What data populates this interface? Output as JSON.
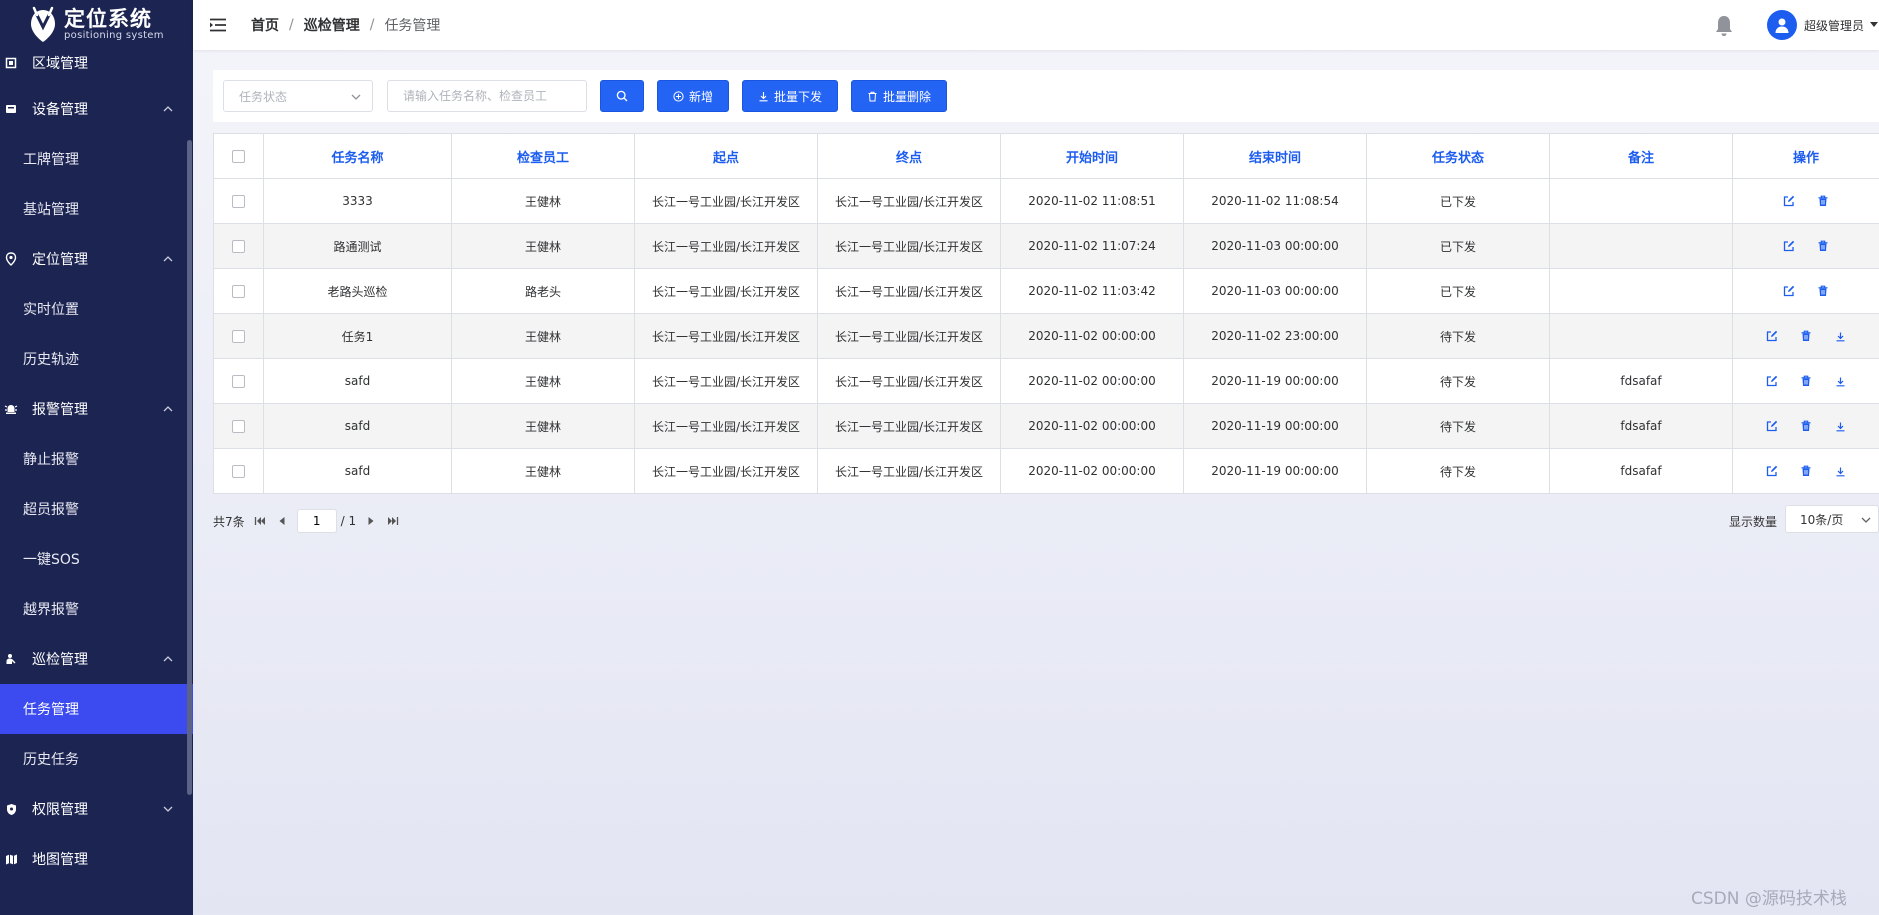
{
  "app": {
    "title": "定位系统",
    "subtitle": "positioning system"
  },
  "sidebar": {
    "groups": [
      {
        "label": "区域管理",
        "icon": "area-icon"
      },
      {
        "label": "设备管理",
        "icon": "device-icon",
        "expanded": true,
        "items": [
          "工牌管理",
          "基站管理"
        ]
      },
      {
        "label": "定位管理",
        "icon": "location-pin-icon",
        "expanded": true,
        "items": [
          "实时位置",
          "历史轨迹"
        ]
      },
      {
        "label": "报警管理",
        "icon": "alarm-icon",
        "expanded": true,
        "items": [
          "静止报警",
          "超员报警",
          "一键SOS",
          "越界报警"
        ]
      },
      {
        "label": "巡检管理",
        "icon": "inspector-icon",
        "expanded": true,
        "items": [
          "任务管理",
          "历史任务"
        ],
        "active_item": "任务管理"
      },
      {
        "label": "权限管理",
        "icon": "shield-icon",
        "expanded": false
      },
      {
        "label": "地图管理",
        "icon": "map-icon",
        "expanded": false
      }
    ],
    "colors": {
      "background": "#1c2452",
      "active": "#3b4bf0"
    }
  },
  "header": {
    "breadcrumb": [
      "首页",
      "巡检管理",
      "任务管理"
    ],
    "separator": "/",
    "user": "超级管理员"
  },
  "toolbar": {
    "status_placeholder": "任务状态",
    "search_placeholder": "请输入任务名称、检查员工",
    "add_label": "新增",
    "batch_issue_label": "批量下发",
    "batch_delete_label": "批量删除",
    "accent": "#2464f5"
  },
  "table": {
    "columns": [
      "任务名称",
      "检查员工",
      "起点",
      "终点",
      "开始时间",
      "结束时间",
      "任务状态",
      "备注",
      "操作"
    ],
    "rows": [
      {
        "name": "3333",
        "inspector": "王健林",
        "start": "长江一号工业园/长江开发区",
        "end": "长江一号工业园/长江开发区",
        "start_time": "2020-11-02 11:08:51",
        "end_time": "2020-11-02 11:08:54",
        "status": "已下发",
        "remark": "",
        "download": false
      },
      {
        "name": "路通测试",
        "inspector": "王健林",
        "start": "长江一号工业园/长江开发区",
        "end": "长江一号工业园/长江开发区",
        "start_time": "2020-11-02 11:07:24",
        "end_time": "2020-11-03 00:00:00",
        "status": "已下发",
        "remark": "",
        "download": false
      },
      {
        "name": "老路头巡检",
        "inspector": "路老头",
        "start": "长江一号工业园/长江开发区",
        "end": "长江一号工业园/长江开发区",
        "start_time": "2020-11-02 11:03:42",
        "end_time": "2020-11-03 00:00:00",
        "status": "已下发",
        "remark": "",
        "download": false
      },
      {
        "name": "任务1",
        "inspector": "王健林",
        "start": "长江一号工业园/长江开发区",
        "end": "长江一号工业园/长江开发区",
        "start_time": "2020-11-02 00:00:00",
        "end_time": "2020-11-02 23:00:00",
        "status": "待下发",
        "remark": "",
        "download": true
      },
      {
        "name": "safd",
        "inspector": "王健林",
        "start": "长江一号工业园/长江开发区",
        "end": "长江一号工业园/长江开发区",
        "start_time": "2020-11-02 00:00:00",
        "end_time": "2020-11-19 00:00:00",
        "status": "待下发",
        "remark": "fdsafaf",
        "download": true
      },
      {
        "name": "safd",
        "inspector": "王健林",
        "start": "长江一号工业园/长江开发区",
        "end": "长江一号工业园/长江开发区",
        "start_time": "2020-11-02 00:00:00",
        "end_time": "2020-11-19 00:00:00",
        "status": "待下发",
        "remark": "fdsafaf",
        "download": true
      },
      {
        "name": "safd",
        "inspector": "王健林",
        "start": "长江一号工业园/长江开发区",
        "end": "长江一号工业园/长江开发区",
        "start_time": "2020-11-02 00:00:00",
        "end_time": "2020-11-19 00:00:00",
        "status": "待下发",
        "remark": "fdsafaf",
        "download": true
      }
    ],
    "header_color": "#1c5df0",
    "action_color": "#1c5df0"
  },
  "pagination": {
    "total": "共7条",
    "current_page": "1",
    "total_pages": "/ 1",
    "page_size_label": "显示数量",
    "page_size": "10条/页"
  },
  "watermark": "CSDN @源码技术栈"
}
